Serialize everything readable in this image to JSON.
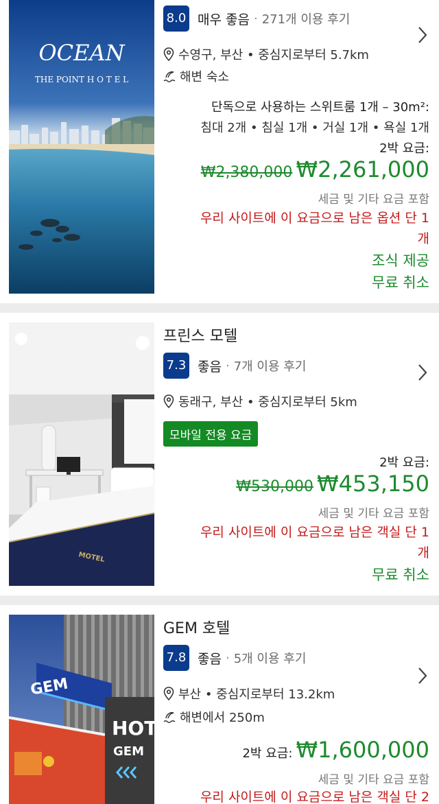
{
  "hotels": [
    {
      "name": "",
      "photo_text": {
        "title": "OCEAN",
        "subtitle": "THE POINT H O T E L"
      },
      "score": "8.0",
      "score_word": "매우 좋음",
      "reviews": "271개 이용 후기",
      "location": "수영구, 부산 • 중심지로부터 5.7km",
      "beach": "해변 숙소",
      "room_line1": "단독으로 사용하는 스위트룸 1개 – 30m²:",
      "room_line2": "침대 2개 • 침실 1개 • 거실 1개 • 욕실 1개",
      "nights_label": "2박 요금:",
      "old_price": "₩2,380,000",
      "new_price": "₩2,261,000",
      "tax_note": "세금 및 기타 요금 포함",
      "urgency_line1": "우리 사이트에 이 요금으로 남은 옵션 단 1",
      "urgency_line2": "개",
      "perk1": "조식 제공",
      "perk2": "무료 취소"
    },
    {
      "name": "프린스 모텔",
      "photo_text": {
        "bed_logo": "MOTEL"
      },
      "score": "7.3",
      "score_word": "좋음",
      "reviews": "7개 이용 후기",
      "location": "동래구, 부산 • 중심지로부터 5km",
      "mobile_badge": "모바일 전용 요금",
      "nights_label": "2박 요금:",
      "old_price": "₩530,000",
      "new_price": "₩453,150",
      "tax_note": "세금 및 기타 요금 포함",
      "urgency_line1": "우리 사이트에 이 요금으로 남은 객실 단 1",
      "urgency_line2": "개",
      "perk1": "무료 취소"
    },
    {
      "name": "GEM 호텔",
      "photo_text": {
        "sign1": "GEM",
        "sign2": "HOT",
        "sign3": "GEM"
      },
      "score": "7.8",
      "score_word": "좋음",
      "reviews": "5개 이용 후기",
      "location": "부산 • 중심지로부터 13.2km",
      "beach": "해변에서 250m",
      "nights_label": "2박 요금:",
      "new_price": "₩1,600,000",
      "tax_note": "세금 및 기타 요금 포함",
      "urgency_line1": "우리 사이트에 이 요금으로 남은 객실 단 2"
    }
  ],
  "colors": {
    "score_badge": "#0b3b8c",
    "price_green": "#1d8a2e",
    "urgent_red": "#c41919",
    "badge_green": "#138a23"
  },
  "icons": {
    "location": "map-pin-icon",
    "beach": "beach-wave-icon",
    "more": "chevron-right-icon"
  }
}
